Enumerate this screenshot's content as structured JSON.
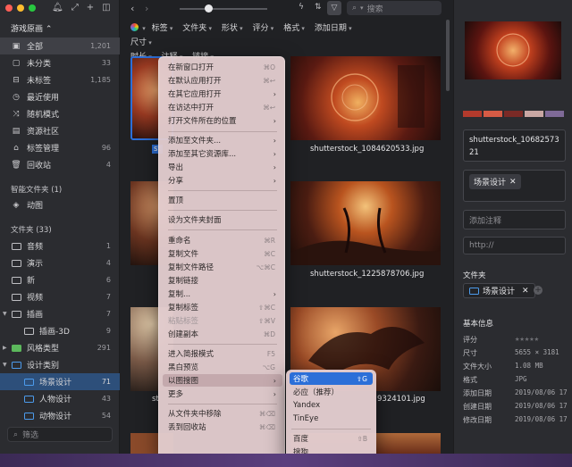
{
  "colors": {
    "accent": "#2c6fd8",
    "traffic_red": "#fe5f57",
    "traffic_yellow": "#febc2e",
    "traffic_green": "#28c840"
  },
  "sidebar": {
    "library": "游戏原画 ⌃",
    "items": [
      {
        "label": "全部",
        "count": "1,201",
        "icon": "image-grid-icon"
      },
      {
        "label": "未分类",
        "count": "33",
        "icon": "uncategorized-icon"
      },
      {
        "label": "未标签",
        "count": "1,185",
        "icon": "untagged-icon"
      },
      {
        "label": "最近使用",
        "count": "",
        "icon": "clock-icon"
      },
      {
        "label": "随机模式",
        "count": "",
        "icon": "shuffle-icon"
      },
      {
        "label": "资源社区",
        "count": "",
        "icon": "community-icon"
      },
      {
        "label": "标签管理",
        "count": "96",
        "icon": "tag-icon"
      },
      {
        "label": "回收站",
        "count": "4",
        "icon": "trash-icon"
      }
    ],
    "smart_title": "智能文件夹 (1)",
    "smart_items": [
      {
        "label": "动图",
        "count": "",
        "icon": "smart-folder-icon"
      }
    ],
    "folders_title": "文件夹 (33)",
    "folders": [
      {
        "label": "音频",
        "count": "1"
      },
      {
        "label": "演示",
        "count": "4"
      },
      {
        "label": "新",
        "count": "6"
      },
      {
        "label": "视频",
        "count": "7"
      },
      {
        "label": "插画",
        "count": "7"
      },
      {
        "label": "插画-3D",
        "count": "9"
      },
      {
        "label": "风格类型",
        "count": "291"
      },
      {
        "label": "设计类别",
        "count": ""
      },
      {
        "label": "场景设计",
        "count": "71"
      },
      {
        "label": "人物设计",
        "count": "43"
      },
      {
        "label": "动物设计",
        "count": "54"
      }
    ],
    "filter_placeholder": "筛选"
  },
  "toolbar": {
    "search_placeholder": "搜索"
  },
  "filters": {
    "row1": [
      "标签",
      "文件夹",
      "形状",
      "评分",
      "格式",
      "添加日期",
      "尺寸"
    ],
    "row2": [
      "时长",
      "注释",
      "链接"
    ]
  },
  "grid": {
    "captions": [
      "st",
      "shutterstock_1084620533.jpg",
      "shutterstock_1225878706.jpg",
      "st",
      "9324101.jpg"
    ]
  },
  "context_menu": {
    "items": [
      {
        "label": "在新窗口打开",
        "shortcut": "⌘O"
      },
      {
        "label": "在默认应用打开",
        "shortcut": "⌘↩"
      },
      {
        "label": "在其它应用打开",
        "shortcut": ""
      },
      {
        "label": "在访达中打开",
        "shortcut": "⌘↩"
      },
      {
        "label": "打开文件所在的位置",
        "shortcut": ""
      },
      {
        "label": "添加至文件夹...",
        "shortcut": ""
      },
      {
        "label": "添加至其它资源库...",
        "shortcut": ""
      },
      {
        "label": "导出",
        "shortcut": ""
      },
      {
        "label": "分享",
        "shortcut": ""
      },
      {
        "label": "置顶",
        "shortcut": ""
      },
      {
        "label": "设为文件夹封面",
        "shortcut": ""
      },
      {
        "label": "重命名",
        "shortcut": "⌘R"
      },
      {
        "label": "复制文件",
        "shortcut": "⌘C"
      },
      {
        "label": "复制文件路径",
        "shortcut": "⌥⌘C"
      },
      {
        "label": "复制链接",
        "shortcut": ""
      },
      {
        "label": "复制...",
        "shortcut": ""
      },
      {
        "label": "复制标签",
        "shortcut": "⇧⌘C"
      },
      {
        "label": "粘贴标签",
        "shortcut": "⇧⌘V"
      },
      {
        "label": "创建副本",
        "shortcut": "⌘D"
      },
      {
        "label": "进入简报模式",
        "shortcut": "F5"
      },
      {
        "label": "黑白预览",
        "shortcut": "⌥G"
      },
      {
        "label": "以图搜图",
        "shortcut": ""
      },
      {
        "label": "更多",
        "shortcut": ""
      },
      {
        "label": "从文件夹中移除",
        "shortcut": "⌘⌫"
      },
      {
        "label": "丢到回收站",
        "shortcut": "⌘⌫"
      }
    ]
  },
  "submenu": {
    "items": [
      {
        "label": "谷歌",
        "shortcut": "⇧G"
      },
      {
        "label": "必应（推荐）",
        "shortcut": ""
      },
      {
        "label": "Yandex",
        "shortcut": ""
      },
      {
        "label": "TinEye",
        "shortcut": ""
      },
      {
        "label": "百度",
        "shortcut": "⇧B"
      },
      {
        "label": "搜狗",
        "shortcut": ""
      }
    ]
  },
  "inspector": {
    "filename": "shutterstock_1068257321",
    "swatches": [
      "#b33a2c",
      "#d65b45",
      "#7a2a26",
      "#c9a7a3",
      "#7f6a98"
    ],
    "tag": "场景设计",
    "note_placeholder": "添加注释",
    "url_placeholder": "http://",
    "folder_title": "文件夹",
    "folder_chip": "场景设计",
    "info_title": "基本信息",
    "info": [
      {
        "k": "评分",
        "v": "★★★★★"
      },
      {
        "k": "尺寸",
        "v": "5655 × 3181"
      },
      {
        "k": "文件大小",
        "v": "1.08 MB"
      },
      {
        "k": "格式",
        "v": "JPG"
      },
      {
        "k": "添加日期",
        "v": "2019/08/06 17"
      },
      {
        "k": "创建日期",
        "v": "2019/08/06 17"
      },
      {
        "k": "修改日期",
        "v": "2019/08/06 17"
      }
    ]
  }
}
